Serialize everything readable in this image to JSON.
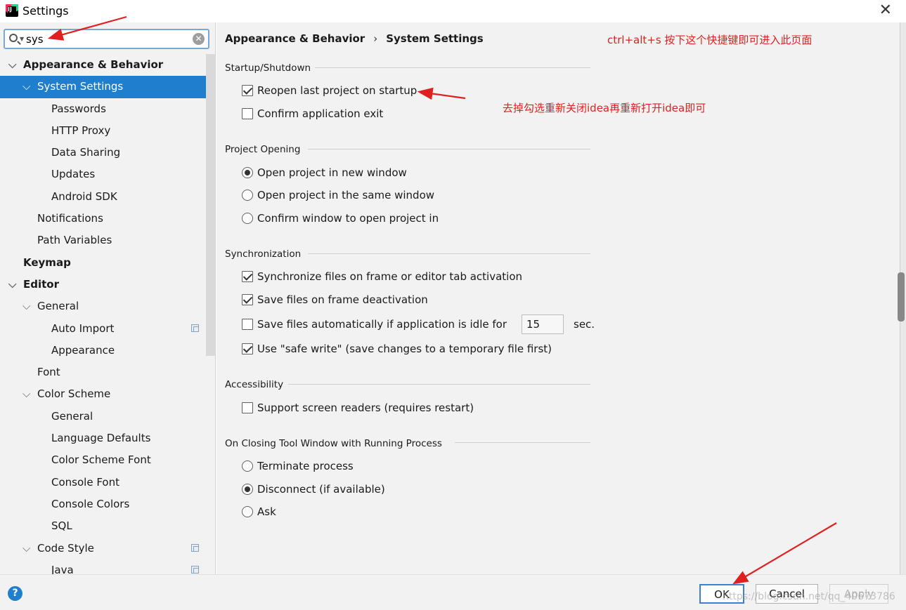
{
  "window": {
    "title": "Settings"
  },
  "search": {
    "value": "sys"
  },
  "tree": [
    {
      "label": "Appearance & Behavior",
      "bold": true,
      "chevron": "expanded",
      "level": 0
    },
    {
      "label": "System Settings",
      "selected": true,
      "chevron": "expanded",
      "level": 1
    },
    {
      "label": "Passwords",
      "level": 2
    },
    {
      "label": "HTTP Proxy",
      "level": 2
    },
    {
      "label": "Data Sharing",
      "level": 2
    },
    {
      "label": "Updates",
      "level": 2
    },
    {
      "label": "Android SDK",
      "level": 2
    },
    {
      "label": "Notifications",
      "level": 1
    },
    {
      "label": "Path Variables",
      "level": 1
    },
    {
      "label": "Keymap",
      "bold": true,
      "level": 0
    },
    {
      "label": "Editor",
      "bold": true,
      "chevron": "expanded",
      "level": 0
    },
    {
      "label": "General",
      "chevron": "expanded",
      "level": 1
    },
    {
      "label": "Auto Import",
      "level": 2,
      "copy_icon": true
    },
    {
      "label": "Appearance",
      "level": 2
    },
    {
      "label": "Font",
      "level": 1
    },
    {
      "label": "Color Scheme",
      "chevron": "expanded",
      "level": 1
    },
    {
      "label": "General",
      "level": 2
    },
    {
      "label": "Language Defaults",
      "level": 2
    },
    {
      "label": "Color Scheme Font",
      "level": 2
    },
    {
      "label": "Console Font",
      "level": 2
    },
    {
      "label": "Console Colors",
      "level": 2
    },
    {
      "label": "SQL",
      "level": 2
    },
    {
      "label": "Code Style",
      "chevron": "expanded",
      "level": 1,
      "copy_icon": true
    },
    {
      "label": "Java",
      "level": 2,
      "copy_icon": true
    }
  ],
  "breadcrumb": {
    "parent": "Appearance & Behavior",
    "separator": "›",
    "current": "System Settings"
  },
  "annotations": {
    "shortcut": "ctrl+alt+s  按下这个快捷键即可进入此页面",
    "uncheck": "去掉勾选重新关闭idea再重新打开idea即可"
  },
  "sections": {
    "startup": {
      "title": "Startup/Shutdown",
      "reopen": "Reopen last project on startup",
      "confirm_exit": "Confirm application exit"
    },
    "opening": {
      "title": "Project Opening",
      "new_window": "Open project in new window",
      "same_window": "Open project in the same window",
      "confirm_window": "Confirm window to open project in"
    },
    "sync": {
      "title": "Synchronization",
      "sync_files": "Synchronize files on frame or editor tab activation",
      "save_deactivation": "Save files on frame deactivation",
      "save_idle": "Save files automatically if application is idle for",
      "idle_seconds": "15",
      "sec_label": "sec.",
      "safe_write": "Use \"safe write\" (save changes to a temporary file first)"
    },
    "accessibility": {
      "title": "Accessibility",
      "screen_readers": "Support screen readers (requires restart)"
    },
    "closing": {
      "title": "On Closing Tool Window with Running Process",
      "terminate": "Terminate process",
      "disconnect": "Disconnect (if available)",
      "ask": "Ask"
    }
  },
  "buttons": {
    "ok": "OK",
    "cancel": "Cancel",
    "apply": "Apply"
  },
  "watermark": "https://blog.csdn.net/qq_40673786",
  "colors": {
    "accent": "#1f7fce",
    "annotation": "#e02020"
  }
}
